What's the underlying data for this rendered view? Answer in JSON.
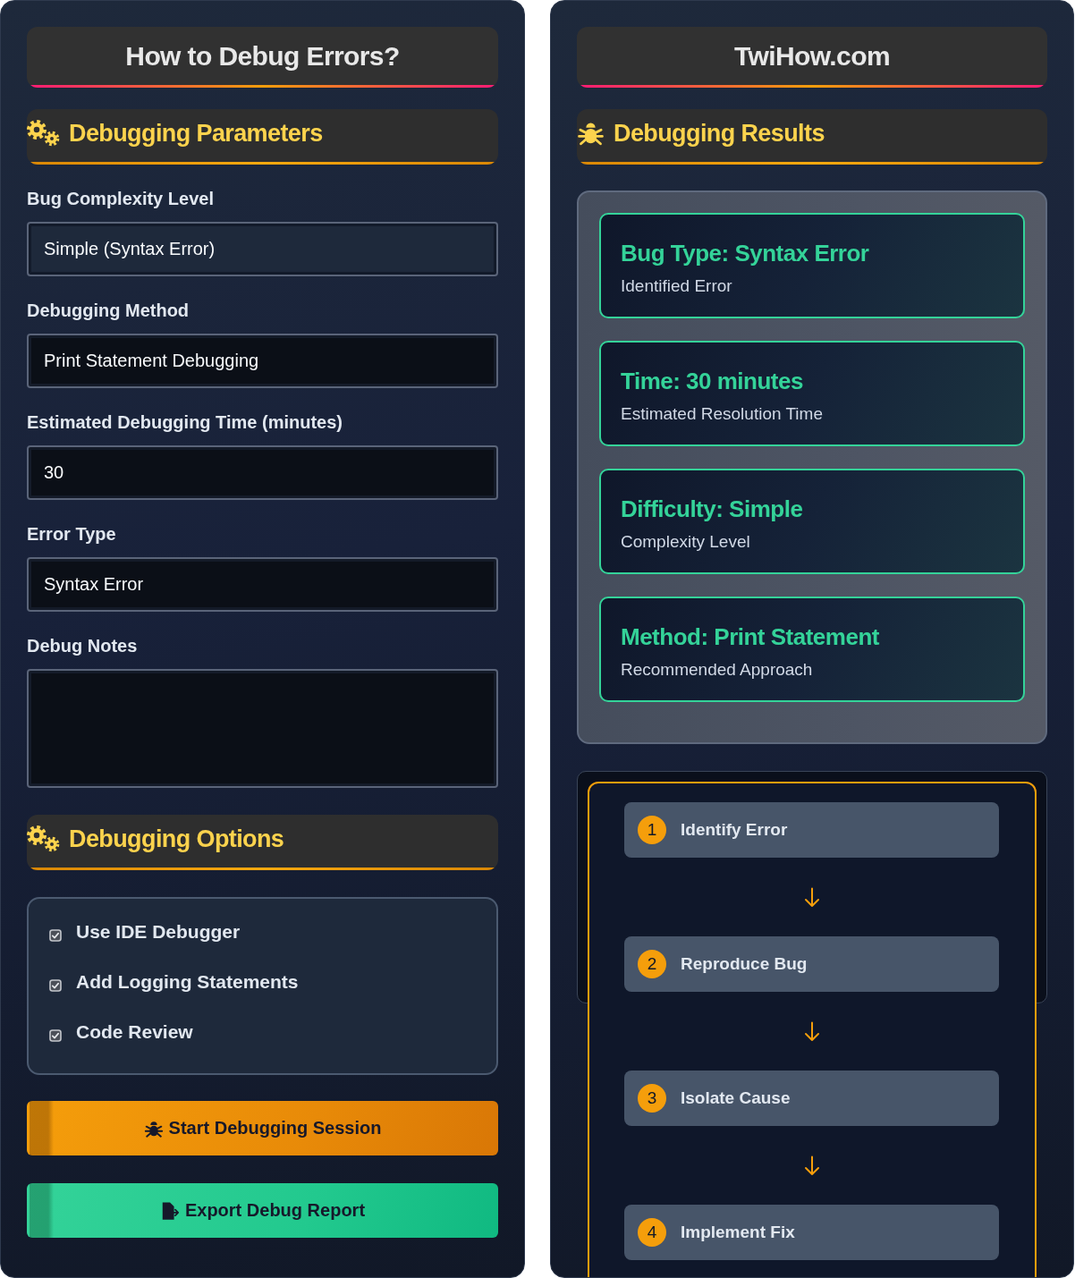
{
  "left_panel": {
    "title": "How to Debug Errors?",
    "parameters": {
      "heading": "Debugging Parameters",
      "fields": [
        {
          "kind": "select",
          "label": "Bug Complexity Level",
          "value": "Simple (Syntax Error)"
        },
        {
          "kind": "input",
          "label": "Debugging Method",
          "value": "Print Statement Debugging"
        },
        {
          "kind": "input",
          "label": "Estimated Debugging Time (minutes)",
          "value": "30"
        },
        {
          "kind": "input",
          "label": "Error Type",
          "value": "Syntax Error"
        },
        {
          "kind": "textarea",
          "label": "Debug Notes"
        }
      ]
    },
    "options": {
      "heading": "Debugging Options",
      "items": [
        {
          "label": "Use IDE Debugger",
          "checked": true
        },
        {
          "label": "Add Logging Statements",
          "checked": true
        },
        {
          "label": "Code Review",
          "checked": true
        }
      ]
    },
    "buttons": [
      {
        "kind": "start",
        "label": "Start Debugging Session"
      },
      {
        "kind": "export",
        "label": "Export Debug Report"
      }
    ]
  },
  "right_panel": {
    "title": "TwiHow.com",
    "results": {
      "heading": "Debugging Results",
      "cards": [
        {
          "title": "Bug Type: Syntax Error",
          "subtitle": "Identified Error"
        },
        {
          "title": "Time: 30 minutes",
          "subtitle": "Estimated Resolution Time"
        },
        {
          "title": "Difficulty: Simple",
          "subtitle": "Complexity Level"
        },
        {
          "title": "Method: Print Statement",
          "subtitle": "Recommended Approach"
        }
      ]
    },
    "steps": [
      {
        "number": "1",
        "label": "Identify Error"
      },
      {
        "number": "2",
        "label": "Reproduce Bug"
      },
      {
        "number": "3",
        "label": "Isolate Cause"
      },
      {
        "number": "4",
        "label": "Implement Fix"
      }
    ]
  }
}
